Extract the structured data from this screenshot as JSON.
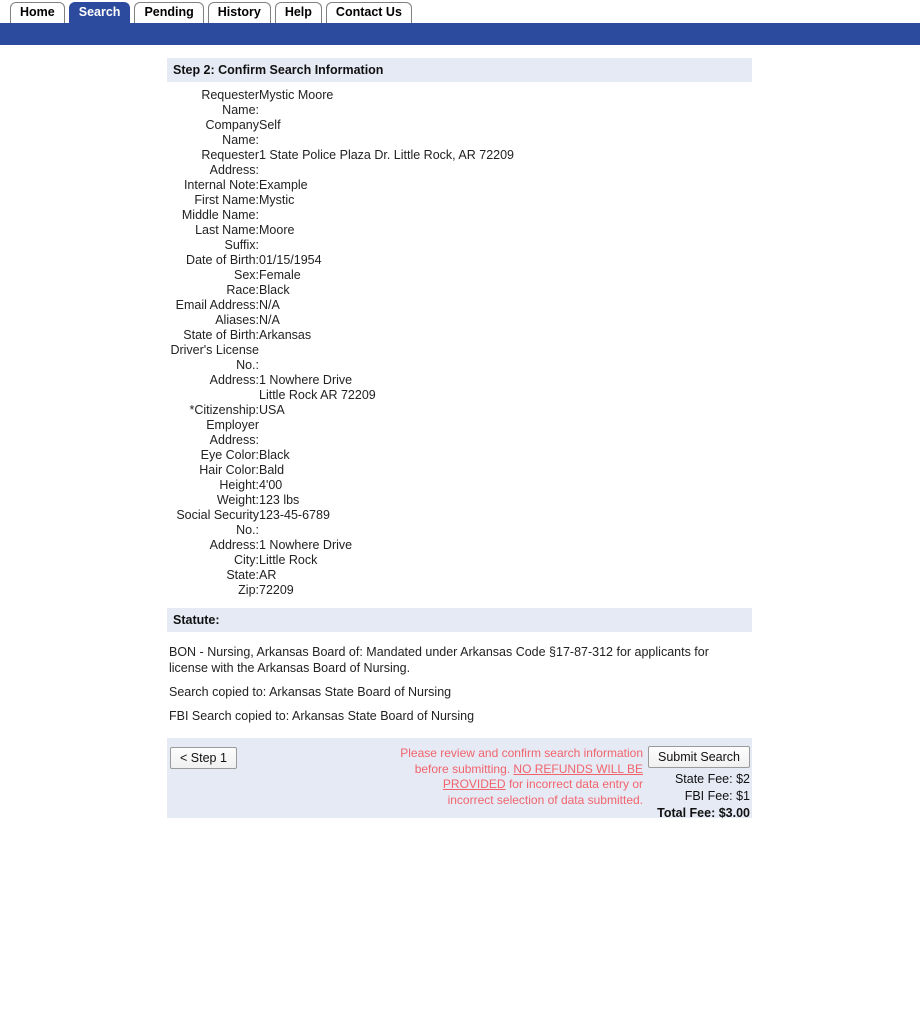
{
  "nav": {
    "tabs": [
      {
        "label": "Home",
        "active": false
      },
      {
        "label": "Search",
        "active": true
      },
      {
        "label": "Pending",
        "active": false
      },
      {
        "label": "History",
        "active": false
      },
      {
        "label": "Help",
        "active": false
      },
      {
        "label": "Contact Us",
        "active": false
      }
    ]
  },
  "section": {
    "title": "Step 2: Confirm Search Information"
  },
  "fields": [
    {
      "label": "Requester Name:",
      "value": "Mystic Moore"
    },
    {
      "label": "Company Name:",
      "value": "Self"
    },
    {
      "label": "Requester Address:",
      "value": "1 State Police Plaza Dr. Little Rock, AR 72209"
    },
    {
      "label": "Internal Note:",
      "value": "Example"
    },
    {
      "label": "First Name:",
      "value": "Mystic"
    },
    {
      "label": "Middle Name:",
      "value": ""
    },
    {
      "label": "Last Name:",
      "value": "Moore"
    },
    {
      "label": "Suffix:",
      "value": ""
    },
    {
      "label": "Date of Birth:",
      "value": "01/15/1954"
    },
    {
      "label": "Sex:",
      "value": "Female"
    },
    {
      "label": "Race:",
      "value": "Black"
    },
    {
      "label": "Email Address:",
      "value": "N/A"
    },
    {
      "label": "Aliases:",
      "value": "N/A"
    },
    {
      "label": "State of Birth:",
      "value": "Arkansas"
    },
    {
      "label": "Driver's License No.:",
      "value": ""
    },
    {
      "label": "Address:",
      "value": "1 Nowhere Drive\nLittle Rock AR 72209"
    },
    {
      "label": "*Citizenship:",
      "value": "USA"
    },
    {
      "label": "Employer Address:",
      "value": ""
    },
    {
      "label": "Eye Color:",
      "value": "Black"
    },
    {
      "label": "Hair Color:",
      "value": "Bald"
    },
    {
      "label": "Height:",
      "value": "4'00"
    },
    {
      "label": "Weight:",
      "value": "123 lbs"
    },
    {
      "label": "Social Security No.:",
      "value": "123-45-6789"
    },
    {
      "label": "Address:",
      "value": "1 Nowhere Drive"
    },
    {
      "label": "City:",
      "value": "Little Rock"
    },
    {
      "label": "State:",
      "value": "AR"
    },
    {
      "label": "Zip:",
      "value": "72209"
    }
  ],
  "statute": {
    "heading": "Statute:",
    "paragraphs": [
      "BON - Nursing, Arkansas Board of: Mandated under Arkansas Code §17-87-312 for applicants for license with the Arkansas Board of Nursing.",
      "Search copied to: Arkansas State Board of Nursing",
      "FBI Search copied to: Arkansas State Board of Nursing"
    ]
  },
  "actions": {
    "back_label": "< Step 1",
    "submit_label": "Submit Search",
    "warning_prefix": "Please review and confirm search information before submitting. ",
    "warning_emphasis": "NO REFUNDS WILL BE PROVIDED",
    "warning_suffix": " for incorrect data entry or incorrect selection of data submitted.",
    "state_fee": "State Fee: $2",
    "fbi_fee": "FBI Fee: $1",
    "total_fee": "Total Fee: $3.00"
  },
  "colors": {
    "nav_blue": "#2c4a9e",
    "section_bg": "#e6eaf5",
    "warning_red": "#f1646c"
  }
}
